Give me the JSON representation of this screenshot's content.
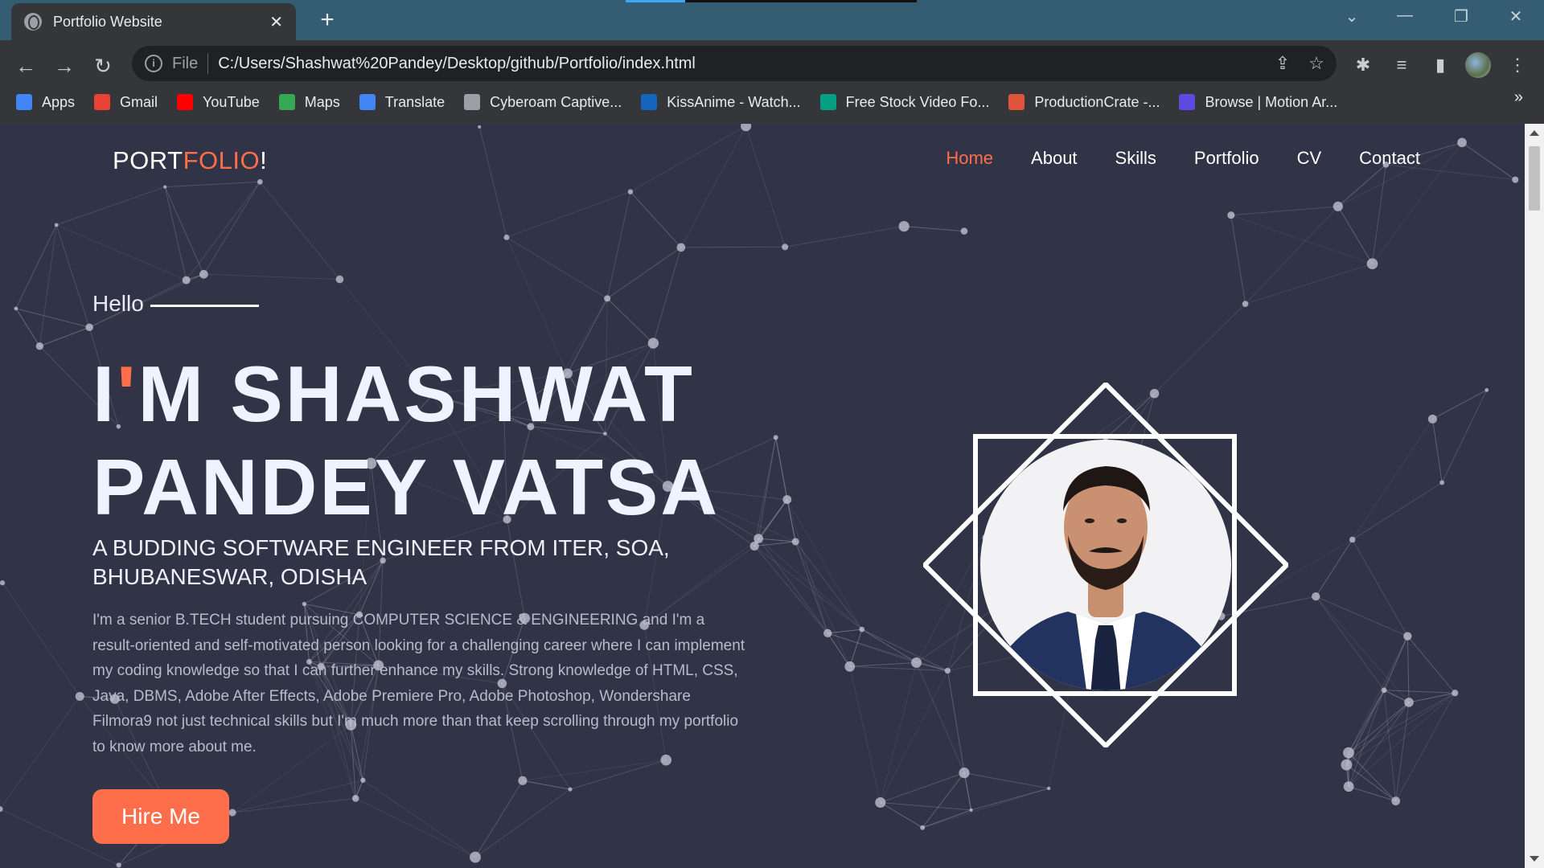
{
  "browser": {
    "tab_title": "Portfolio Website",
    "tab_close": "✕",
    "new_tab": "+",
    "url_scheme": "File",
    "url": "C:/Users/Shashwat%20Pandey/Desktop/github/Portfolio/index.html",
    "bookmarks": [
      {
        "label": "Apps",
        "color": "#4285f4"
      },
      {
        "label": "Gmail",
        "color": "#ea4335"
      },
      {
        "label": "YouTube",
        "color": "#ff0000"
      },
      {
        "label": "Maps",
        "color": "#34a853"
      },
      {
        "label": "Translate",
        "color": "#4285f4"
      },
      {
        "label": "Cyberoam Captive...",
        "color": "#9aa0a6"
      },
      {
        "label": "KissAnime - Watch...",
        "color": "#1565c0"
      },
      {
        "label": "Free Stock Video Fo...",
        "color": "#05a081"
      },
      {
        "label": "ProductionCrate -...",
        "color": "#e0533d"
      },
      {
        "label": "Browse | Motion Ar...",
        "color": "#5b4be0"
      }
    ],
    "bookmarks_more": "»"
  },
  "page": {
    "logo_part1": "PORT",
    "logo_part2": "FOLIO",
    "logo_part3": "!",
    "nav": [
      "Home",
      "About",
      "Skills",
      "Portfolio",
      "CV",
      "Contact"
    ],
    "nav_active": "Home",
    "hello": "Hello",
    "name_line1_a": "I",
    "name_line1_apos": "'",
    "name_line1_b": "M SHASHWAT",
    "name_line2": "PANDEY VATSA",
    "subtitle": "A BUDDING SOFTWARE ENGINEER FROM ITER, SOA, BHUBANESWAR, ODISHA",
    "bio": "I'm a senior B.TECH student pursuing COMPUTER SCIENCE & ENGINEERING and I'm a result-oriented and self-motivated person looking for a challenging career where I can implement my coding knowledge so that I can further enhance my skills. Strong knowledge of HTML, CSS, Java, DBMS, Adobe After Effects, Adobe Premiere Pro, Adobe Photoshop, Wondershare Filmora9 not just technical skills but I'm much more than that keep scrolling through my portfolio to know more about me.",
    "hire_button": "Hire Me",
    "accent_color": "#ff6e4a",
    "background_color": "#313346"
  }
}
